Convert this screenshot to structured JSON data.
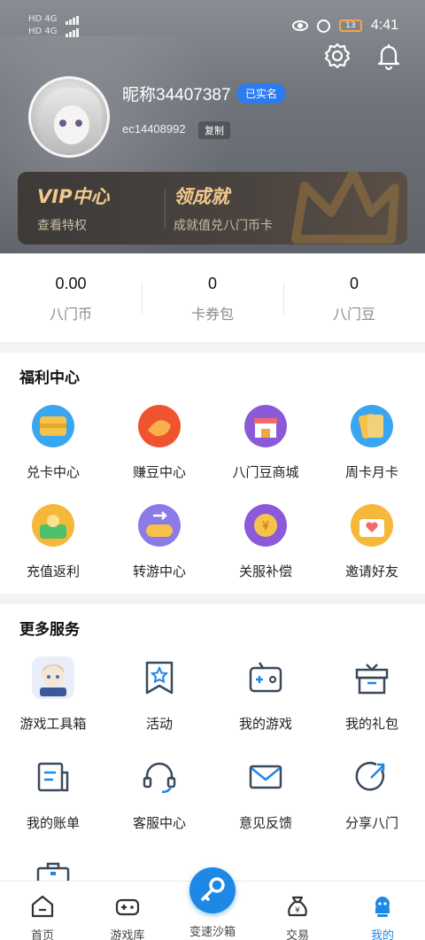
{
  "status_bar": {
    "left_top": "HD 4G",
    "left_bottom": "HD 4G",
    "battery": "13",
    "time": "4:41"
  },
  "profile": {
    "nickname": "昵称34407387",
    "verified_badge": "已实名",
    "user_id": "ec14408992",
    "copy_label": "复制"
  },
  "vip": {
    "vip_title": "VIP中心",
    "vip_sub": "查看特权",
    "achieve_title": "领成就",
    "achieve_sub": "成就值兑八门币卡"
  },
  "stats": [
    {
      "value": "0.00",
      "label": "八门币"
    },
    {
      "value": "0",
      "label": "卡券包"
    },
    {
      "value": "0",
      "label": "八门豆"
    }
  ],
  "welfare": {
    "title": "福利中心",
    "items": [
      {
        "label": "兑卡中心",
        "icon": "card-exchange-icon",
        "color": "#f5b83a"
      },
      {
        "label": "赚豆中心",
        "icon": "earn-beans-icon",
        "color": "#f0532f"
      },
      {
        "label": "八门豆商城",
        "icon": "store-icon",
        "color": "#8c5ad8"
      },
      {
        "label": "周卡月卡",
        "icon": "weekly-card-icon",
        "color": "#f5b83a"
      },
      {
        "label": "充值返利",
        "icon": "recharge-icon",
        "color": "#f5b83a"
      },
      {
        "label": "转游中心",
        "icon": "transfer-game-icon",
        "color": "#8c7ae6"
      },
      {
        "label": "关服补偿",
        "icon": "compensation-icon",
        "color": "#8c5ad8"
      },
      {
        "label": "邀请好友",
        "icon": "invite-icon",
        "color": "#f5b83a"
      }
    ]
  },
  "services": {
    "title": "更多服务",
    "items": [
      {
        "label": "游戏工具箱",
        "icon": "game-toolbox-icon"
      },
      {
        "label": "活动",
        "icon": "activity-icon"
      },
      {
        "label": "我的游戏",
        "icon": "my-games-icon"
      },
      {
        "label": "我的礼包",
        "icon": "gift-icon"
      },
      {
        "label": "我的账单",
        "icon": "bill-icon"
      },
      {
        "label": "客服中心",
        "icon": "headset-icon"
      },
      {
        "label": "意见反馈",
        "icon": "mail-icon"
      },
      {
        "label": "分享八门",
        "icon": "share-icon"
      }
    ]
  },
  "nav": {
    "items": [
      {
        "label": "首页",
        "icon": "home-icon"
      },
      {
        "label": "游戏库",
        "icon": "gamepad-icon"
      },
      {
        "label": "变速沙箱",
        "icon": "key-icon"
      },
      {
        "label": "交易",
        "icon": "money-bag-icon"
      },
      {
        "label": "我的",
        "icon": "profile-icon"
      }
    ],
    "active_color": "#1e88e5"
  },
  "colors": {
    "accent": "#2b7cf0",
    "vip_gold": "#f2c98a"
  }
}
